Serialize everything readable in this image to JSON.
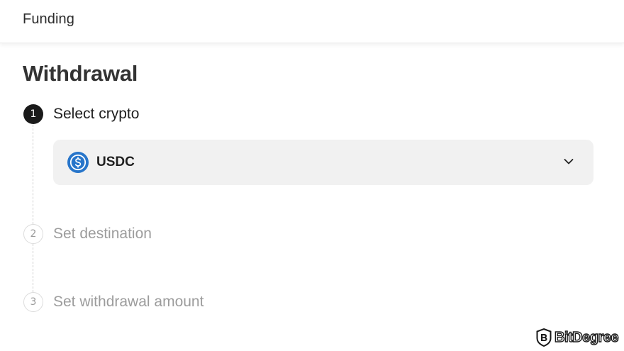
{
  "header": {
    "title": "Funding"
  },
  "main": {
    "title": "Withdrawal",
    "steps": [
      {
        "number": "1",
        "label": "Select crypto",
        "state": "active"
      },
      {
        "number": "2",
        "label": "Set destination",
        "state": "inactive"
      },
      {
        "number": "3",
        "label": "Set withdrawal amount",
        "state": "inactive"
      }
    ],
    "crypto_select": {
      "selected_value": "USDC",
      "icon": "usdc-coin-icon",
      "chevron_icon": "chevron-down-icon"
    }
  },
  "watermark": {
    "text": "BitDegree",
    "icon": "bitdegree-logo-icon"
  },
  "colors": {
    "active_step": "#1a1a1a",
    "inactive_text": "#9c9c9c",
    "select_background": "#f1f1f1",
    "usdc_blue": "#2775ca"
  }
}
